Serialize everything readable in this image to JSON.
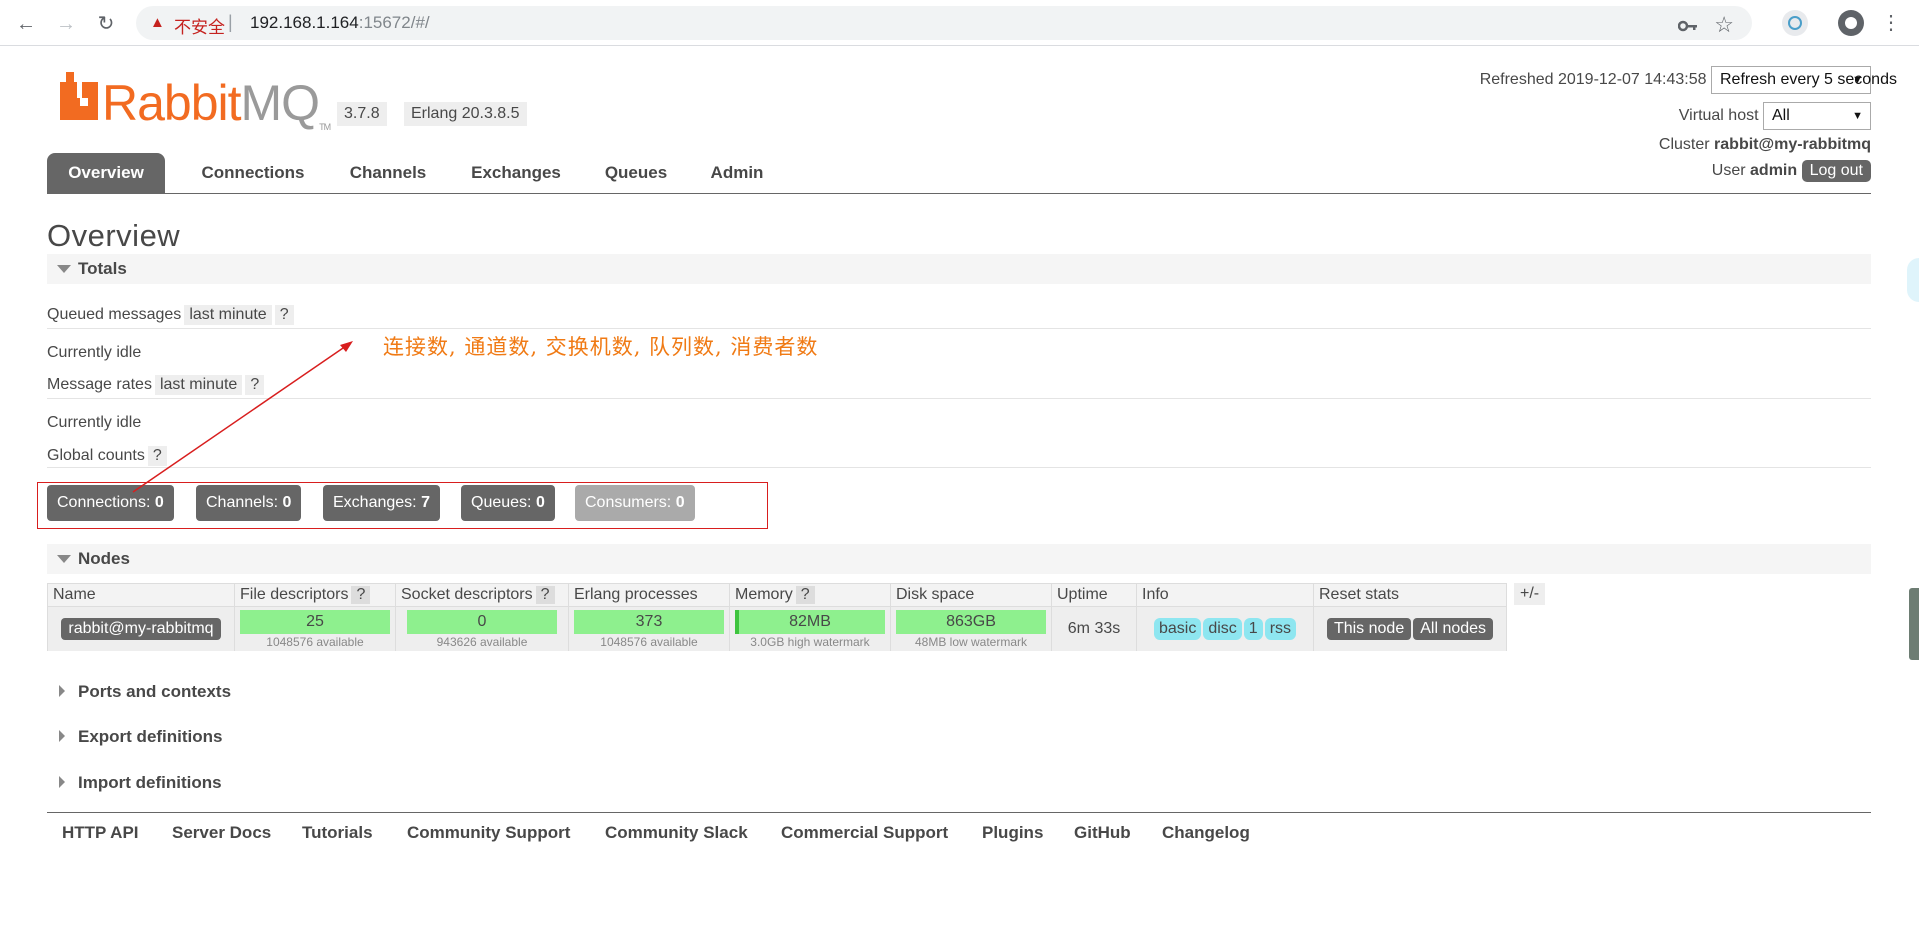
{
  "browser": {
    "back": "←",
    "forward": "→",
    "reload": "↻",
    "security_icon": "▲",
    "insecure_label": "不安全",
    "separator": "|",
    "host": "192.168.1.164",
    "path": ":15672/#/",
    "key_icon": "key-icon",
    "star_icon": "☆",
    "menu_icon": "⋮"
  },
  "logo": {
    "rabbit": "Rabbit",
    "mq": "MQ",
    "tm": "TM"
  },
  "versions": [
    "3.7.8",
    "Erlang 20.3.8.5"
  ],
  "header": {
    "refreshed_label": "Refreshed 2019-12-07 14:43:58",
    "refresh_select": "Refresh every 5 seconds",
    "vhost_label": "Virtual host",
    "vhost_select": "All",
    "cluster_label": "Cluster",
    "cluster_name": "rabbit@my-rabbitmq",
    "user_label": "User",
    "user_name": "admin",
    "logout": "Log out"
  },
  "tabs": [
    "Overview",
    "Connections",
    "Channels",
    "Exchanges",
    "Queues",
    "Admin"
  ],
  "overview": {
    "title": "Overview",
    "totals_label": "Totals",
    "queued_label": "Queued messages",
    "queued_chip": "last minute",
    "help": "?",
    "idle_1": "Currently idle",
    "rates_label": "Message rates",
    "rates_chip": "last minute",
    "idle_2": "Currently idle",
    "global_label": "Global counts",
    "counts": [
      {
        "label": "Connections:",
        "value": "0"
      },
      {
        "label": "Channels:",
        "value": "0"
      },
      {
        "label": "Exchanges:",
        "value": "7"
      },
      {
        "label": "Queues:",
        "value": "0"
      },
      {
        "label": "Consumers:",
        "value": "0"
      }
    ],
    "annotation": "连接数, 通道数, 交换机数, 队列数, 消费者数"
  },
  "nodes": {
    "section_label": "Nodes",
    "headers": [
      "Name",
      "File descriptors",
      "Socket descriptors",
      "Erlang processes",
      "Memory",
      "Disk space",
      "Uptime",
      "Info",
      "Reset stats"
    ],
    "row": {
      "name": "rabbit@my-rabbitmq",
      "fd": "25",
      "fd_sub": "1048576 available",
      "sd": "0",
      "sd_sub": "943626 available",
      "ep": "373",
      "ep_sub": "1048576 available",
      "mem": "82MB",
      "mem_sub": "3.0GB high watermark",
      "disk": "863GB",
      "disk_sub": "48MB low watermark",
      "uptime": "6m 33s",
      "info": [
        "basic",
        "disc",
        "1",
        "rss"
      ],
      "reset": [
        "This node",
        "All nodes"
      ]
    },
    "plusminus": "+/-"
  },
  "collapsed_sections": [
    "Ports and contexts",
    "Export definitions",
    "Import definitions"
  ],
  "footer": [
    "HTTP API",
    "Server Docs",
    "Tutorials",
    "Community Support",
    "Community Slack",
    "Commercial Support",
    "Plugins",
    "GitHub",
    "Changelog"
  ]
}
